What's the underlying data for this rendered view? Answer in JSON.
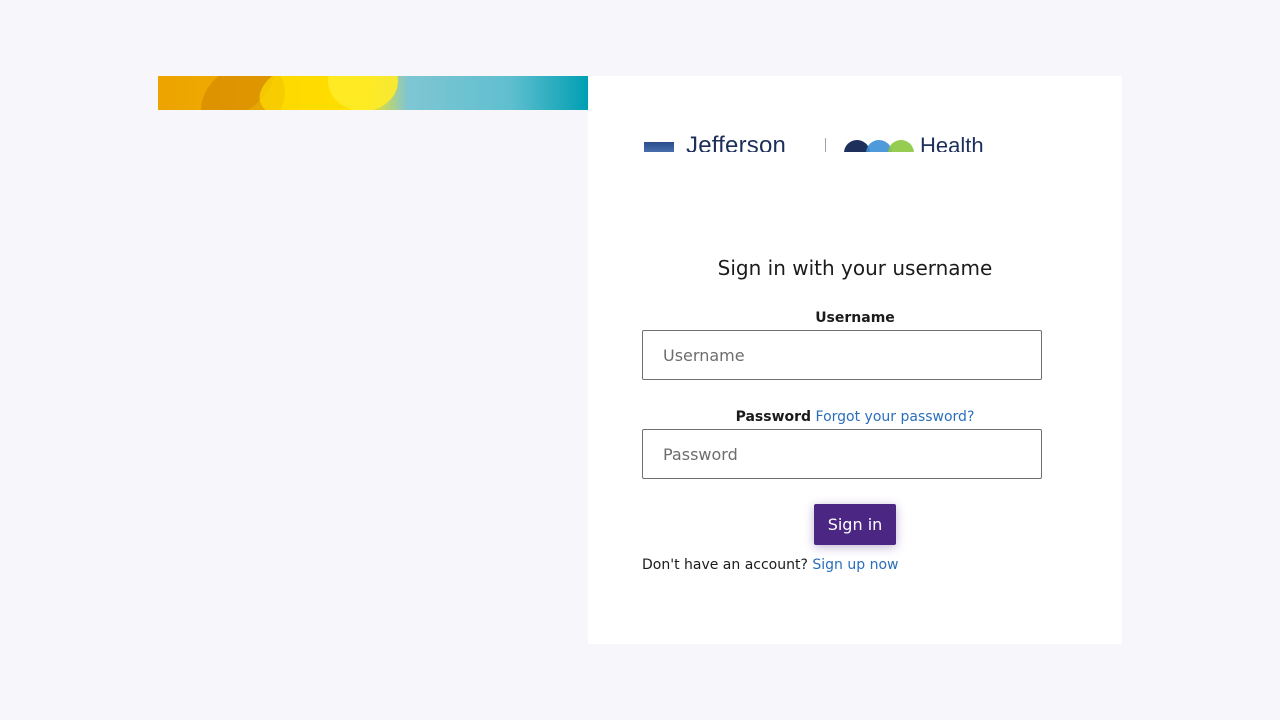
{
  "logo": {
    "left_text": "Jefferson",
    "right_text": "Health",
    "circle_colors": [
      "#1e2f5c",
      "#3b8fd6",
      "#8cc63f"
    ]
  },
  "form": {
    "heading": "Sign in with your username",
    "username_label": "Username",
    "username_placeholder": "Username",
    "password_label": "Password",
    "forgot_link": "Forgot your password?",
    "password_placeholder": "Password",
    "signin_button": "Sign in",
    "no_account_text": "Don't have an account?",
    "signup_link": "Sign up now"
  },
  "colors": {
    "primary_button": "#4b2682",
    "link": "#2a6ebb",
    "page_background": "#f7f7fb"
  }
}
